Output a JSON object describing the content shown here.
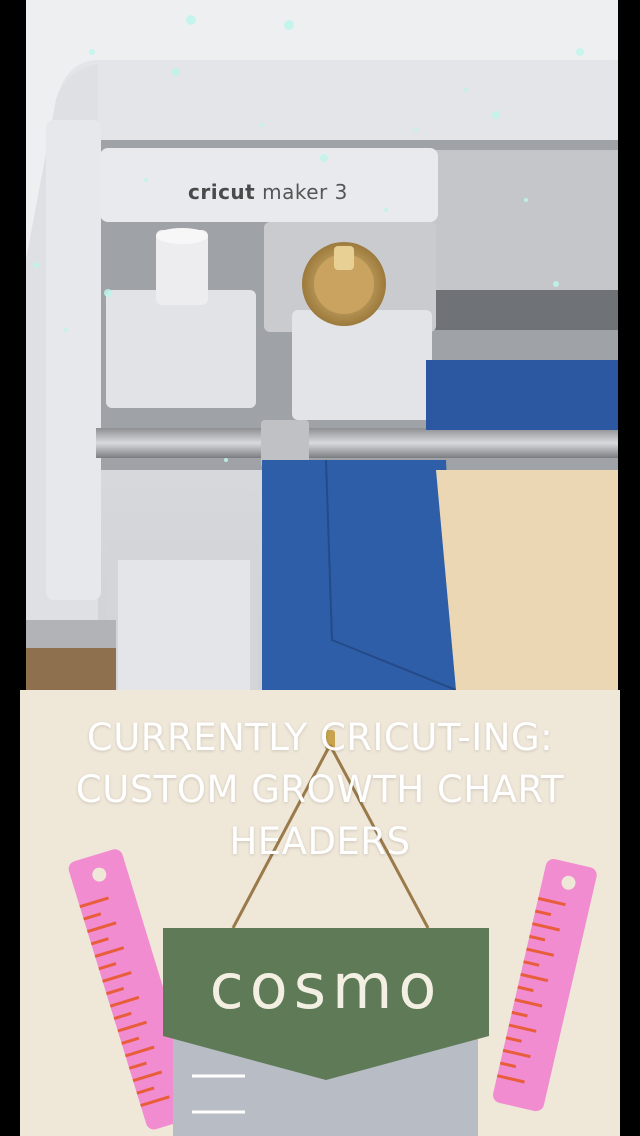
{
  "photo": {
    "machine_brand": "cricut",
    "machine_model": "maker 3"
  },
  "overlay": {
    "headline_lines": [
      "CURRENTLY CRICUT-ING:",
      "CUSTOM GROWTH CHART",
      "HEADERS"
    ]
  },
  "sign": {
    "name": "cosmo"
  },
  "colors": {
    "background": "#000000",
    "card_background": "#efe7d8",
    "sign_green": "#5e7a57",
    "ruler_pink": "#f08ccf",
    "mat_blue": "#2e5ea8",
    "headline_text": "#ffffff"
  }
}
